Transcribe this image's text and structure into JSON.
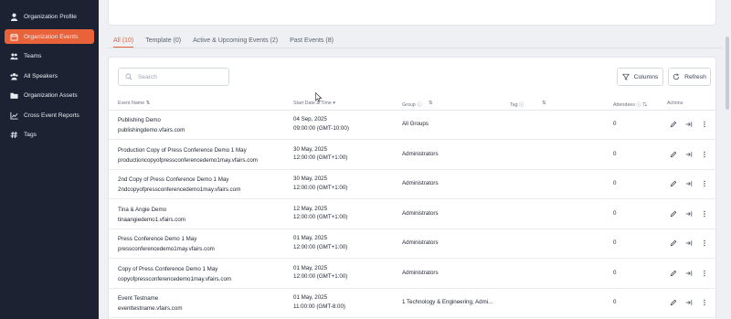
{
  "sidebar": {
    "items": [
      {
        "label": "Organization Profile",
        "icon": "user-icon"
      },
      {
        "label": "Organization Events",
        "icon": "calendar-icon",
        "active": true
      },
      {
        "label": "Teams",
        "icon": "teams-icon"
      },
      {
        "label": "All Speakers",
        "icon": "speakers-icon"
      },
      {
        "label": "Organization Assets",
        "icon": "folder-icon"
      },
      {
        "label": "Cross Event Reports",
        "icon": "chart-icon"
      },
      {
        "label": "Tags",
        "icon": "hash-icon"
      }
    ],
    "accent": "#e8623a",
    "background": "#1d2233"
  },
  "tabs": [
    {
      "label": "All (10)",
      "active": true
    },
    {
      "label": "Template (0)"
    },
    {
      "label": "Active & Upcoming Events (2)"
    },
    {
      "label": "Past Events (8)"
    }
  ],
  "toolbar": {
    "search_placeholder": "Search",
    "columns_label": "Columns",
    "refresh_label": "Refresh"
  },
  "table": {
    "headers": {
      "event_name": "Event Name ⇅",
      "start_date": "Start Date & Time ▾",
      "group": "Group ⓘ",
      "group_sort": "⇅",
      "tag": "Tag ⓘ",
      "tag_sort": "⇅",
      "attendees": "Attendees ⓘ ⇅",
      "actions": "Actions"
    },
    "rows": [
      {
        "name": "Publishing Demo",
        "url": "publishingdemo.vfairs.com",
        "date": "04 Sep, 2025",
        "time": "09:00:00 (GMT-10:00)",
        "group": "All Groups",
        "attendees": "0"
      },
      {
        "name": "Production Copy of Press Conference Demo 1 May",
        "url": "productioncopyofpressconferencedemo1may.vfairs.com",
        "date": "30 May, 2025",
        "time": "12:00:00 (GMT+1:00)",
        "group": "Administrators",
        "attendees": "0"
      },
      {
        "name": "2nd Copy of Press Conference Demo 1 May",
        "url": "2ndcopyofpressconferencedemo1may.vfairs.com",
        "date": "30 May, 2025",
        "time": "12:00:00 (GMT+1:00)",
        "group": "Administrators",
        "attendees": "0"
      },
      {
        "name": "Tina & Angie Demo",
        "url": "tinaangiedemo1.vfairs.com",
        "date": "12 May, 2025",
        "time": "12:00:00 (GMT+1:00)",
        "group": "Administrators",
        "attendees": "0"
      },
      {
        "name": "Press Conference Demo 1 May",
        "url": "pressconferencedemo1may.vfairs.com",
        "date": "01 May, 2025",
        "time": "12:00:00 (GMT+1:00)",
        "group": "Administrators",
        "attendees": "0"
      },
      {
        "name": "Copy of Press Conference Demo 1 May",
        "url": "copyofpressconferencedemo1may.vfairs.com",
        "date": "01 May, 2025",
        "time": "12:00:00 (GMT+1:00)",
        "group": "Administrators",
        "attendees": "0"
      },
      {
        "name": "Event Testname",
        "url": "eventtestname.vfairs.com",
        "date": "01 May, 2025",
        "time": "11:00:00 (GMT-8:00)",
        "group": "1 Technology & Engineering, Admi...",
        "attendees": "0"
      }
    ]
  }
}
